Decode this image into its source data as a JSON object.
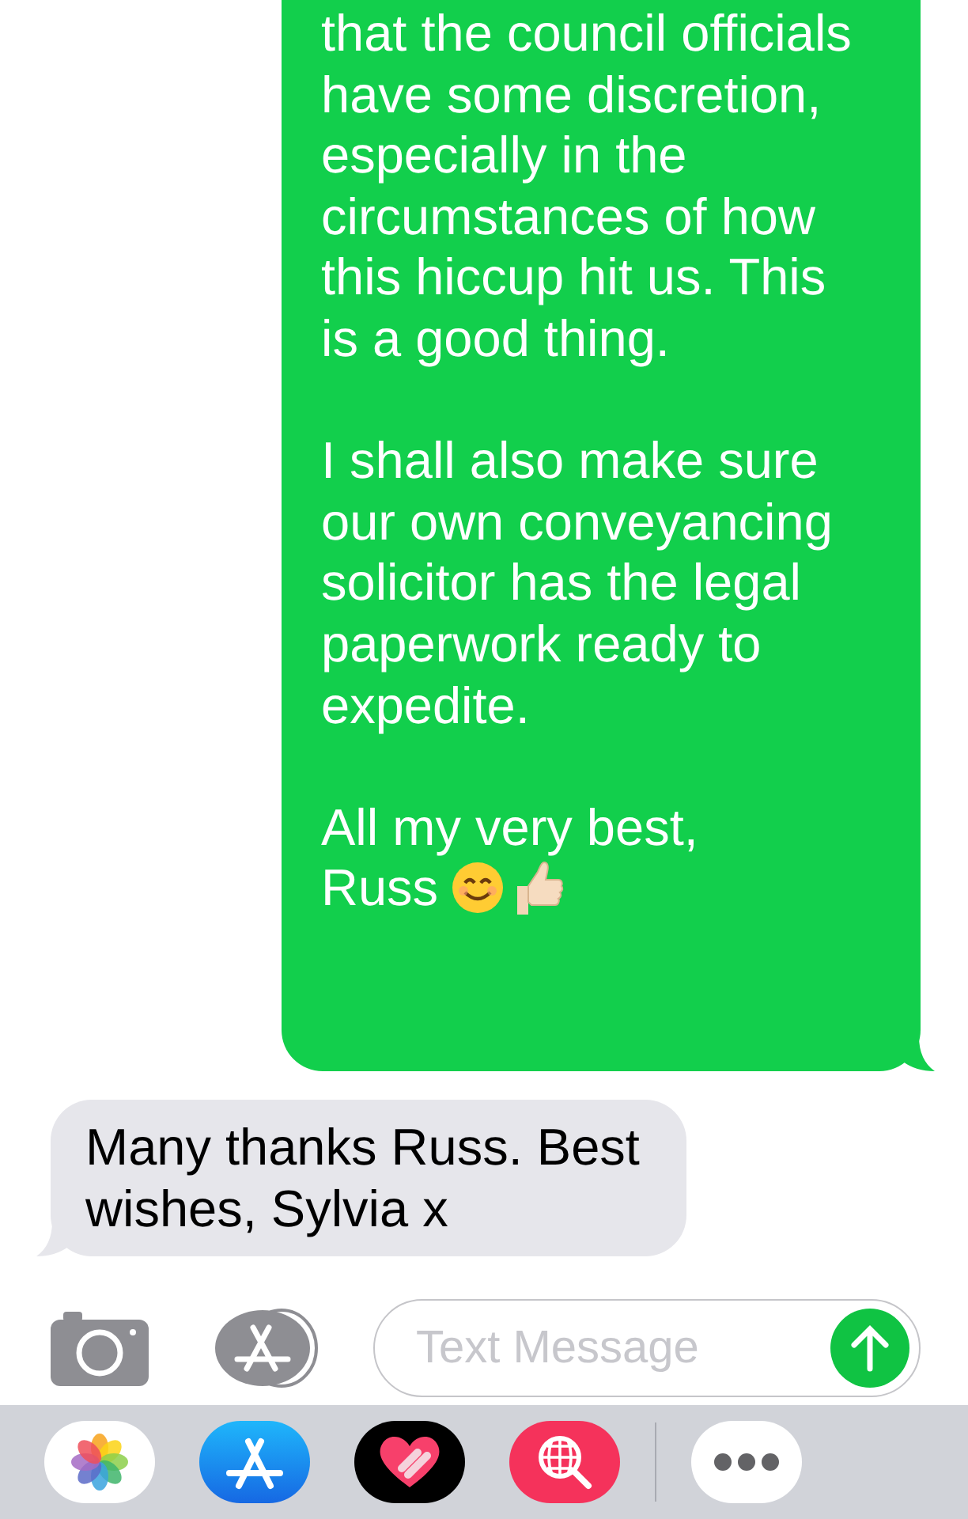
{
  "messages": [
    {
      "kind": "sent",
      "paragraphs": [
        [
          "that the council officials",
          "have some discretion,",
          "especially in the",
          "circumstances of how",
          "this hiccup hit us. This",
          "is a good thing."
        ],
        [
          "I shall also make sure",
          "our own conveyancing",
          "solicitor has the legal",
          "paperwork ready to",
          "expedite."
        ],
        [
          "All my very best,",
          "Russ"
        ]
      ],
      "emoji": true
    },
    {
      "kind": "received",
      "paragraphs": [
        [
          "Many thanks Russ. Best",
          "wishes, Sylvia x"
        ]
      ],
      "emoji": false
    }
  ],
  "composer": {
    "placeholder": "Text Message"
  }
}
